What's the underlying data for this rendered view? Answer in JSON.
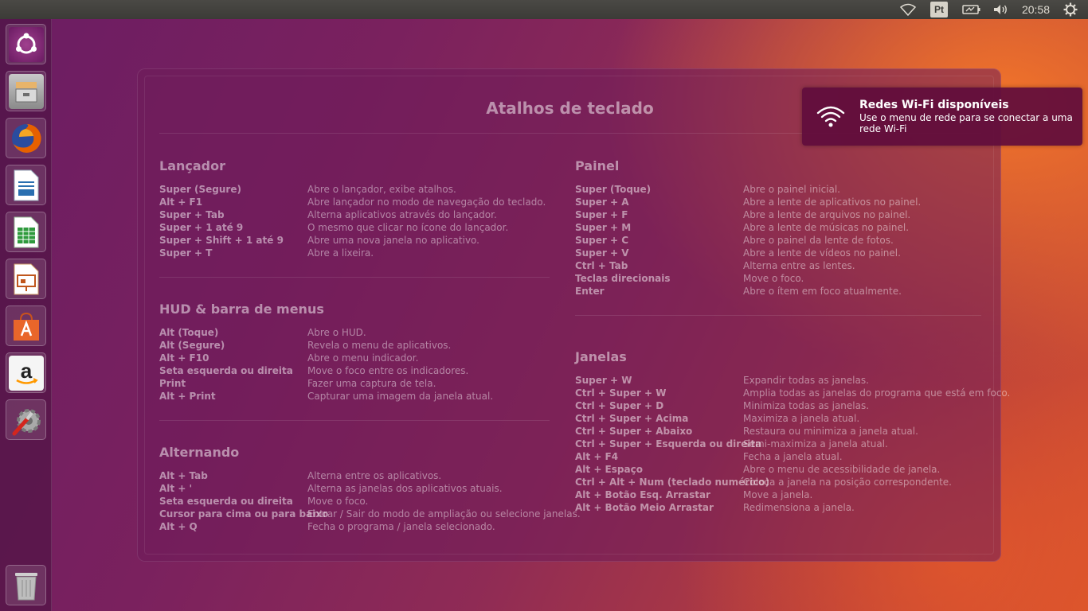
{
  "top_panel": {
    "keyboard_layout": "Pt",
    "clock": "20:58",
    "icons": [
      "wifi-icon",
      "battery-icon",
      "volume-icon",
      "gear-icon"
    ]
  },
  "launcher": {
    "items": [
      {
        "name": "ubuntu-dash",
        "icon": "ubuntu-logo-icon",
        "color": "#8a2a80"
      },
      {
        "name": "files",
        "icon": "file-cabinet-icon",
        "color": "#8e8e8e"
      },
      {
        "name": "firefox",
        "icon": "firefox-icon",
        "color": "#e66000"
      },
      {
        "name": "libreoffice-writer",
        "icon": "writer-icon",
        "color": "#2a6fb0"
      },
      {
        "name": "libreoffice-calc",
        "icon": "calc-icon",
        "color": "#2e9a3c"
      },
      {
        "name": "libreoffice-impress",
        "icon": "impress-icon",
        "color": "#c0561c"
      },
      {
        "name": "ubuntu-software",
        "icon": "software-bag-icon",
        "color": "#e9662a"
      },
      {
        "name": "amazon",
        "icon": "amazon-icon",
        "color": "#f5f5f5"
      },
      {
        "name": "system-settings",
        "icon": "settings-wrench-icon",
        "color": "#9a9a9a"
      },
      {
        "name": "trash",
        "icon": "trash-icon",
        "color": "#b8b8b8"
      }
    ]
  },
  "overlay": {
    "title": "Atalhos de teclado",
    "left": [
      {
        "heading": "Lançador",
        "rows": [
          {
            "k": "Super (Segure)",
            "d": "Abre o lançador, exibe atalhos."
          },
          {
            "k": "Alt + F1",
            "d": "Abre lançador no modo de navegação do teclado."
          },
          {
            "k": "Super + Tab",
            "d": "Alterna aplicativos através do lançador."
          },
          {
            "k": "Super + 1 até 9",
            "d": "O mesmo que clicar no ícone do lançador."
          },
          {
            "k": "Super + Shift + 1 até 9",
            "d": "Abre uma nova janela no aplicativo."
          },
          {
            "k": "Super + T",
            "d": "Abre a lixeira."
          }
        ]
      },
      {
        "heading": "HUD & barra de menus",
        "rows": [
          {
            "k": "Alt (Toque)",
            "d": "Abre o HUD."
          },
          {
            "k": "Alt (Segure)",
            "d": "Revela o menu de aplicativos."
          },
          {
            "k": "Alt + F10",
            "d": "Abre o menu indicador."
          },
          {
            "k": "Seta esquerda ou direita",
            "d": "Move o foco entre os indicadores."
          },
          {
            "k": "Print",
            "d": "Fazer uma captura de tela."
          },
          {
            "k": "Alt + Print",
            "d": "Capturar uma imagem da janela atual."
          }
        ]
      },
      {
        "heading": "Alternando",
        "rows": [
          {
            "k": "Alt + Tab",
            "d": "Alterna entre os aplicativos."
          },
          {
            "k": "Alt + '",
            "d": "Alterna as janelas dos aplicativos atuais."
          },
          {
            "k": "Seta esquerda ou direita",
            "d": "Move o foco."
          },
          {
            "k": "Cursor para cima ou para baixo",
            "d": "Entrar / Sair do modo de ampliação ou selecione janelas."
          },
          {
            "k": "Alt + Q",
            "d": "Fecha o programa / janela selecionado."
          }
        ]
      }
    ],
    "right": [
      {
        "heading": "Painel",
        "rows": [
          {
            "k": "Super (Toque)",
            "d": "Abre o painel inicial."
          },
          {
            "k": "Super + A",
            "d": "Abre a lente de aplicativos no painel."
          },
          {
            "k": "Super + F",
            "d": "Abre a lente de arquivos no painel."
          },
          {
            "k": "Super + M",
            "d": "Abre a lente de músicas no painel."
          },
          {
            "k": "Super + C",
            "d": "Abre o painel da lente de fotos."
          },
          {
            "k": "Super + V",
            "d": "Abre a lente de vídeos no painel."
          },
          {
            "k": "Ctrl + Tab",
            "d": "Alterna entre as lentes."
          },
          {
            "k": "Teclas direcionais",
            "d": "Move o foco."
          },
          {
            "k": "Enter",
            "d": "Abre o ítem em foco atualmente."
          }
        ]
      },
      {
        "heading": "Janelas",
        "rows": [
          {
            "k": "Super + W",
            "d": "Expandir todas as janelas."
          },
          {
            "k": "Ctrl + Super + W",
            "d": "Amplia todas as janelas do programa que está em foco."
          },
          {
            "k": "Ctrl + Super + D",
            "d": "Minimiza todas as janelas."
          },
          {
            "k": "Ctrl + Super + Acima",
            "d": "Maximiza a janela atual."
          },
          {
            "k": "Ctrl + Super + Abaixo",
            "d": "Restaura ou minimiza a janela atual."
          },
          {
            "k": "Ctrl + Super + Esquerda ou direita",
            "d": "Semi-maximiza a janela atual."
          },
          {
            "k": "Alt + F4",
            "d": "Fecha a janela atual."
          },
          {
            "k": "Alt + Espaço",
            "d": "Abre o menu de acessibilidade de janela."
          },
          {
            "k": "Ctrl + Alt + Num (teclado numérico)",
            "d": "Coloca a janela na posição correspondente."
          },
          {
            "k": "Alt + Botão Esq. Arrastar",
            "d": "Move a janela."
          },
          {
            "k": "Alt + Botão Meio Arrastar",
            "d": "Redimensiona a janela."
          }
        ]
      }
    ]
  },
  "notification": {
    "title": "Redes Wi-Fi disponíveis",
    "body": "Use o menu de rede para se conectar a uma rede Wi-Fi",
    "icon": "wifi-icon"
  }
}
